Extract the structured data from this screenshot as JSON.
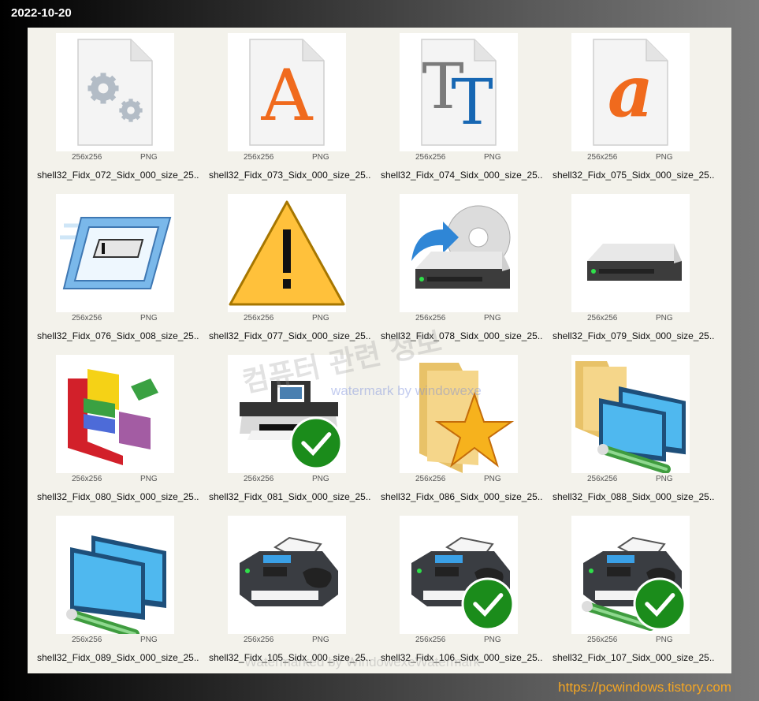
{
  "date": "2022-10-20",
  "url": "https://pcwindows.tistory.com",
  "watermark_korean": "컴퓨터 관련 정보",
  "watermark_english": "watermark by windowexe",
  "watermark_bottom": "Watermarked by WindowexeWatermark",
  "items": [
    {
      "icon": "settings-file-icon",
      "size": "256x256",
      "format": "PNG",
      "name": "shell32_Fidx_072_Sidx_000_size_25..."
    },
    {
      "icon": "font-a-file-icon",
      "size": "256x256",
      "format": "PNG",
      "name": "shell32_Fidx_073_Sidx_000_size_25..."
    },
    {
      "icon": "truetype-font-file-icon",
      "size": "256x256",
      "format": "PNG",
      "name": "shell32_Fidx_074_Sidx_000_size_25..."
    },
    {
      "icon": "italic-font-file-icon",
      "size": "256x256",
      "format": "PNG",
      "name": "shell32_Fidx_075_Sidx_000_size_25..."
    },
    {
      "icon": "window-shortcut-icon",
      "size": "256x256",
      "format": "PNG",
      "name": "shell32_Fidx_076_Sidx_008_size_25..."
    },
    {
      "icon": "warning-icon",
      "size": "256x256",
      "format": "PNG",
      "name": "shell32_Fidx_077_Sidx_000_size_25..."
    },
    {
      "icon": "cd-drive-install-icon",
      "size": "256x256",
      "format": "PNG",
      "name": "shell32_Fidx_078_Sidx_000_size_25..."
    },
    {
      "icon": "hard-drive-icon",
      "size": "256x256",
      "format": "PNG",
      "name": "shell32_Fidx_079_Sidx_000_size_25..."
    },
    {
      "icon": "defrag-blocks-icon",
      "size": "256x256",
      "format": "PNG",
      "name": "shell32_Fidx_080_Sidx_000_size_25..."
    },
    {
      "icon": "default-printer-icon",
      "size": "256x256",
      "format": "PNG",
      "name": "shell32_Fidx_081_Sidx_000_size_25..."
    },
    {
      "icon": "favorites-folder-icon",
      "size": "256x256",
      "format": "PNG",
      "name": "shell32_Fidx_086_Sidx_000_size_25..."
    },
    {
      "icon": "network-folder-icon",
      "size": "256x256",
      "format": "PNG",
      "name": "shell32_Fidx_088_Sidx_000_size_25..."
    },
    {
      "icon": "network-computers-icon",
      "size": "256x256",
      "format": "PNG",
      "name": "shell32_Fidx_089_Sidx_000_size_25..."
    },
    {
      "icon": "fax-printer-icon",
      "size": "256x256",
      "format": "PNG",
      "name": "shell32_Fidx_105_Sidx_000_size_25..."
    },
    {
      "icon": "default-fax-icon",
      "size": "256x256",
      "format": "PNG",
      "name": "shell32_Fidx_106_Sidx_000_size_25..."
    },
    {
      "icon": "network-default-fax-icon",
      "size": "256x256",
      "format": "PNG",
      "name": "shell32_Fidx_107_Sidx_000_size_25..."
    }
  ]
}
